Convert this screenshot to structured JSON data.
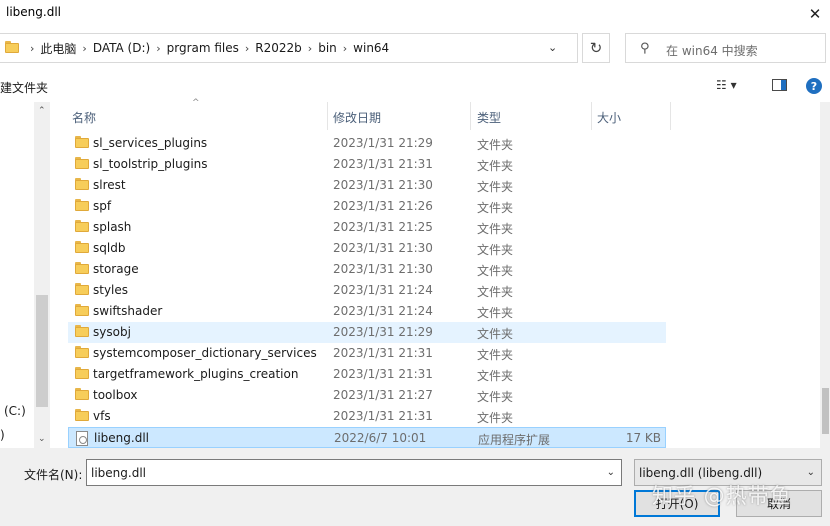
{
  "window": {
    "title": "libeng.dll"
  },
  "address": {
    "crumbs": [
      "此电脑",
      "DATA (D:)",
      "prgram files",
      "R2022b",
      "bin",
      "win64"
    ]
  },
  "search": {
    "placeholder": "在 win64 中搜索"
  },
  "toolbar": {
    "new_folder": "建文件夹"
  },
  "nav": {
    "items": [
      "(C:)",
      ")"
    ]
  },
  "columns": {
    "name": "名称",
    "date": "修改日期",
    "type": "类型",
    "size": "大小"
  },
  "files": [
    {
      "name": "sl_services_plugins",
      "date": "2023/1/31 21:29",
      "type": "文件夹",
      "size": "",
      "kind": "folder"
    },
    {
      "name": "sl_toolstrip_plugins",
      "date": "2023/1/31 21:31",
      "type": "文件夹",
      "size": "",
      "kind": "folder"
    },
    {
      "name": "slrest",
      "date": "2023/1/31 21:30",
      "type": "文件夹",
      "size": "",
      "kind": "folder"
    },
    {
      "name": "spf",
      "date": "2023/1/31 21:26",
      "type": "文件夹",
      "size": "",
      "kind": "folder"
    },
    {
      "name": "splash",
      "date": "2023/1/31 21:25",
      "type": "文件夹",
      "size": "",
      "kind": "folder"
    },
    {
      "name": "sqldb",
      "date": "2023/1/31 21:30",
      "type": "文件夹",
      "size": "",
      "kind": "folder"
    },
    {
      "name": "storage",
      "date": "2023/1/31 21:30",
      "type": "文件夹",
      "size": "",
      "kind": "folder"
    },
    {
      "name": "styles",
      "date": "2023/1/31 21:24",
      "type": "文件夹",
      "size": "",
      "kind": "folder"
    },
    {
      "name": "swiftshader",
      "date": "2023/1/31 21:24",
      "type": "文件夹",
      "size": "",
      "kind": "folder"
    },
    {
      "name": "sysobj",
      "date": "2023/1/31 21:29",
      "type": "文件夹",
      "size": "",
      "kind": "folder",
      "state": "hover"
    },
    {
      "name": "systemcomposer_dictionary_services",
      "date": "2023/1/31 21:31",
      "type": "文件夹",
      "size": "",
      "kind": "folder"
    },
    {
      "name": "targetframework_plugins_creation",
      "date": "2023/1/31 21:31",
      "type": "文件夹",
      "size": "",
      "kind": "folder"
    },
    {
      "name": "toolbox",
      "date": "2023/1/31 21:27",
      "type": "文件夹",
      "size": "",
      "kind": "folder"
    },
    {
      "name": "vfs",
      "date": "2023/1/31 21:31",
      "type": "文件夹",
      "size": "",
      "kind": "folder"
    },
    {
      "name": "libeng.dll",
      "date": "2022/6/7 10:01",
      "type": "应用程序扩展",
      "size": "17 KB",
      "kind": "dll",
      "state": "selected"
    }
  ],
  "footer": {
    "filename_label": "文件名(N):",
    "filename_value": "libeng.dll",
    "filter_value": "libeng.dll (libeng.dll)",
    "open_label": "打开(O)",
    "cancel_label": "取消"
  },
  "watermark": "知乎 @热带鱼"
}
